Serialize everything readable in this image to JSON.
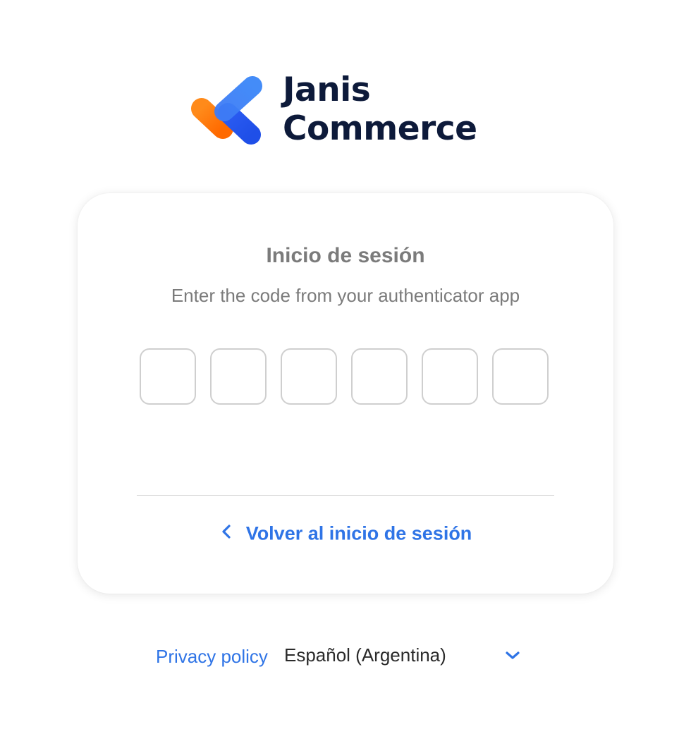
{
  "brand": {
    "name_line1": "Janis",
    "name_line2": "Commerce",
    "logo_icon": "janis-logo-icon",
    "colors": {
      "text": "#0d1a3a",
      "orange": "#ff7a00",
      "blue": "#2f6bf0"
    }
  },
  "login_card": {
    "title": "Inicio de sesión",
    "subtitle": "Enter the code from your authenticator app",
    "otp_digits": [
      "",
      "",
      "",
      "",
      "",
      ""
    ],
    "back_link": {
      "icon": "chevron-left-icon",
      "label": "Volver al inicio de sesión"
    }
  },
  "footer": {
    "privacy_label": "Privacy policy",
    "language": {
      "selected": "Español (Argentina)",
      "icon": "chevron-down-icon"
    }
  },
  "colors": {
    "accent": "#2f74e6",
    "muted_text": "#7b7b7b",
    "input_border": "#cfcfcf"
  }
}
